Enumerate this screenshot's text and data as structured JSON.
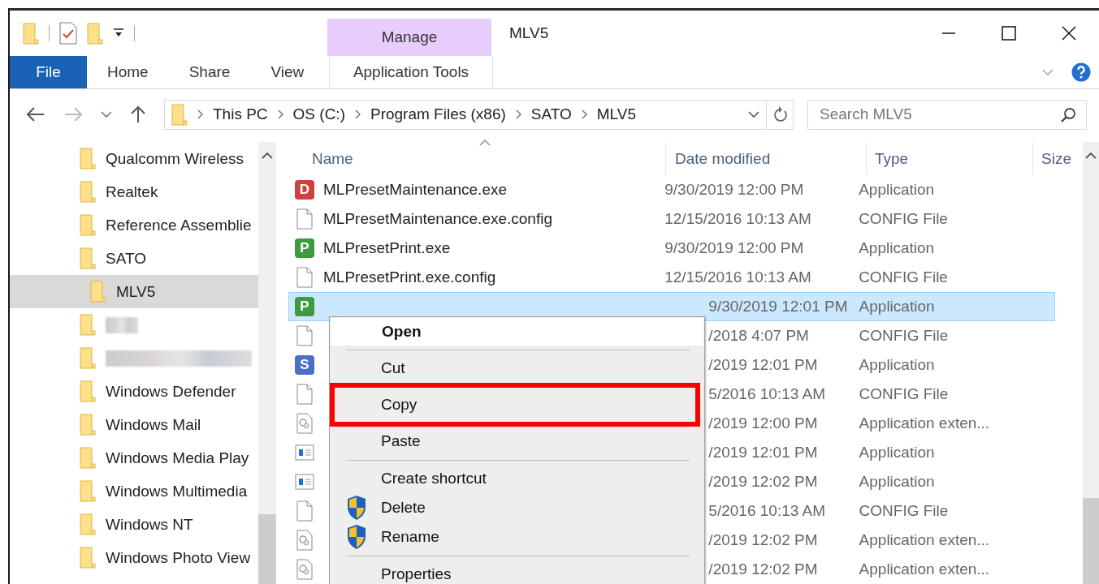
{
  "window": {
    "title": "MLV5"
  },
  "context_tab": {
    "group": "Manage",
    "label": "Application Tools",
    "selected": false
  },
  "ribbon_tabs": [
    {
      "kind": "file",
      "label": "File",
      "selected": false
    },
    {
      "kind": "tab",
      "label": "Home",
      "selected": false
    },
    {
      "kind": "tab",
      "label": "Share",
      "selected": false
    },
    {
      "kind": "tab",
      "label": "View",
      "selected": false
    }
  ],
  "address": {
    "segments": [
      "This PC",
      "OS (C:)",
      "Program Files (x86)",
      "SATO",
      "MLV5"
    ]
  },
  "search": {
    "placeholder": "Search MLV5"
  },
  "nav": {
    "items": [
      {
        "kind": "folder",
        "label": "Qualcomm Wireless",
        "selected": false
      },
      {
        "kind": "folder",
        "label": "Realtek",
        "selected": false
      },
      {
        "kind": "folder",
        "label": "Reference Assemblie",
        "selected": false
      },
      {
        "kind": "folder",
        "label": "SATO",
        "selected": false,
        "children": [
          {
            "kind": "folder",
            "label": "MLV5",
            "selected": true
          }
        ]
      },
      {
        "kind": "redacted",
        "selected": false
      },
      {
        "kind": "redacted",
        "selected": false
      },
      {
        "kind": "folder",
        "label": "Windows Defender",
        "selected": false
      },
      {
        "kind": "folder",
        "label": "Windows Mail",
        "selected": false
      },
      {
        "kind": "folder",
        "label": "Windows Media Play",
        "selected": false
      },
      {
        "kind": "folder",
        "label": "Windows Multimedia",
        "selected": false
      },
      {
        "kind": "folder",
        "label": "Windows NT",
        "selected": false
      },
      {
        "kind": "folder",
        "label": "Windows Photo View",
        "selected": false
      }
    ]
  },
  "files": {
    "columns": [
      "Name",
      "Date modified",
      "Type",
      "Size"
    ],
    "rows": [
      {
        "kind": "app",
        "badge": "D",
        "color": "#d23f3f",
        "name": "MLPresetMaintenance.exe",
        "date": "9/30/2019 12:00 PM",
        "type": "Application",
        "selected": false
      },
      {
        "kind": "doc",
        "name": "MLPresetMaintenance.exe.config",
        "date": "12/15/2016 10:13 AM",
        "type": "CONFIG File",
        "selected": false
      },
      {
        "kind": "app",
        "badge": "P",
        "color": "#3f9a3f",
        "name": "MLPresetPrint.exe",
        "date": "9/30/2019 12:00 PM",
        "type": "Application",
        "selected": false
      },
      {
        "kind": "doc",
        "name": "MLPresetPrint.exe.config",
        "date": "12/15/2016 10:13 AM",
        "type": "CONFIG File",
        "selected": false
      },
      {
        "kind": "app",
        "badge": "P",
        "color": "#3f9a3f",
        "date": "9/30/2019 12:01 PM",
        "type": "Application",
        "selected": true
      },
      {
        "kind": "doc",
        "date": "/2018 4:07 PM",
        "type": "CONFIG File",
        "selected": false
      },
      {
        "kind": "app",
        "badge": "S",
        "color": "#4a6fc7",
        "date": "/2019 12:01 PM",
        "type": "Application",
        "selected": false
      },
      {
        "kind": "doc",
        "date": "5/2016 10:13 AM",
        "type": "CONFIG File",
        "selected": false
      },
      {
        "kind": "dll",
        "date": "/2019 12:00 PM",
        "type": "Application exten...",
        "selected": false
      },
      {
        "kind": "window",
        "date": "/2019 12:01 PM",
        "type": "Application",
        "selected": false
      },
      {
        "kind": "window",
        "date": "/2019 12:02 PM",
        "type": "Application",
        "selected": false
      },
      {
        "kind": "doc",
        "date": "5/2016 10:13 AM",
        "type": "CONFIG File",
        "selected": false
      },
      {
        "kind": "dll",
        "date": "/2019 12:02 PM",
        "type": "Application exten...",
        "selected": false
      },
      {
        "kind": "dll",
        "date": "/2019 12:02 PM",
        "type": "Application exten...",
        "selected": false
      }
    ]
  },
  "context_menu": {
    "items": [
      {
        "kind": "item",
        "label": "Open",
        "default": true,
        "highlighted": false,
        "shield": false
      },
      {
        "kind": "separator"
      },
      {
        "kind": "item",
        "label": "Cut",
        "default": false,
        "highlighted": false,
        "shield": false
      },
      {
        "kind": "item",
        "label": "Copy",
        "default": false,
        "highlighted": true,
        "shield": false
      },
      {
        "kind": "item",
        "label": "Paste",
        "default": false,
        "highlighted": false,
        "shield": false
      },
      {
        "kind": "separator"
      },
      {
        "kind": "item",
        "label": "Create shortcut",
        "default": false,
        "highlighted": false,
        "shield": false
      },
      {
        "kind": "item",
        "label": "Delete",
        "default": false,
        "highlighted": false,
        "shield": true
      },
      {
        "kind": "item",
        "label": "Rename",
        "default": false,
        "highlighted": false,
        "shield": true
      },
      {
        "kind": "separator"
      },
      {
        "kind": "item",
        "label": "Properties",
        "default": false,
        "highlighted": false,
        "shield": false
      }
    ]
  }
}
